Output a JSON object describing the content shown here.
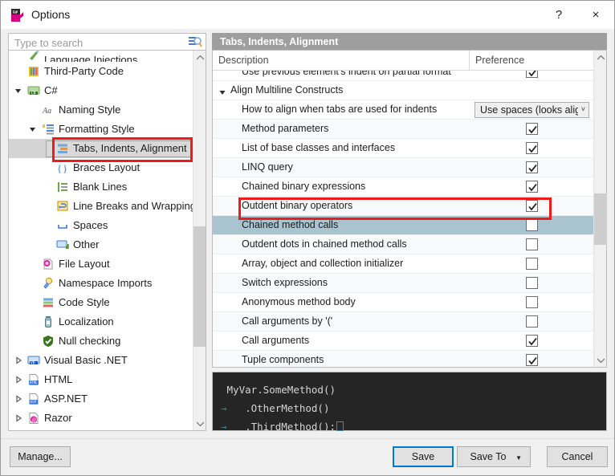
{
  "window": {
    "title": "Options",
    "icon": "resharper-icon",
    "help_label": "?",
    "close_label": "×"
  },
  "search": {
    "placeholder": "Type to search",
    "value": "",
    "icon": "search-icon"
  },
  "sidebar": {
    "items": [
      {
        "label": "Language Injections",
        "icon": "language-injections-icon",
        "indent": 1,
        "expander": "none",
        "clipped": true,
        "selected": false
      },
      {
        "label": "Third-Party Code",
        "icon": "third-party-code-icon",
        "indent": 1,
        "expander": "none",
        "selected": false
      },
      {
        "label": "C#",
        "icon": "csharp-icon",
        "indent": 1,
        "expander": "expanded",
        "selected": false
      },
      {
        "label": "Naming Style",
        "icon": "naming-style-icon",
        "indent": 2,
        "expander": "none",
        "selected": false
      },
      {
        "label": "Formatting Style",
        "icon": "formatting-style-icon",
        "indent": 2,
        "expander": "expanded",
        "selected": false
      },
      {
        "label": "Tabs, Indents, Alignment",
        "icon": "tabs-indents-alignment-icon",
        "indent": 3,
        "expander": "none",
        "selected": true
      },
      {
        "label": "Braces Layout",
        "icon": "braces-layout-icon",
        "indent": 3,
        "expander": "none",
        "selected": false
      },
      {
        "label": "Blank Lines",
        "icon": "blank-lines-icon",
        "indent": 3,
        "expander": "none",
        "selected": false
      },
      {
        "label": "Line Breaks and Wrapping",
        "icon": "line-breaks-wrapping-icon",
        "indent": 3,
        "expander": "none",
        "selected": false
      },
      {
        "label": "Spaces",
        "icon": "spaces-icon",
        "indent": 3,
        "expander": "none",
        "selected": false
      },
      {
        "label": "Other",
        "icon": "other-icon",
        "indent": 3,
        "expander": "none",
        "selected": false
      },
      {
        "label": "File Layout",
        "icon": "file-layout-icon",
        "indent": 2,
        "expander": "none",
        "selected": false
      },
      {
        "label": "Namespace Imports",
        "icon": "namespace-imports-icon",
        "indent": 2,
        "expander": "none",
        "selected": false
      },
      {
        "label": "Code Style",
        "icon": "code-style-icon",
        "indent": 2,
        "expander": "none",
        "selected": false
      },
      {
        "label": "Localization",
        "icon": "localization-icon",
        "indent": 2,
        "expander": "none",
        "selected": false
      },
      {
        "label": "Null checking",
        "icon": "null-checking-icon",
        "indent": 2,
        "expander": "none",
        "selected": false
      },
      {
        "label": "Visual Basic .NET",
        "icon": "visual-basic-net-icon",
        "indent": 1,
        "expander": "collapsed",
        "selected": false
      },
      {
        "label": "HTML",
        "icon": "html-icon",
        "indent": 1,
        "expander": "collapsed",
        "selected": false
      },
      {
        "label": "ASP.NET",
        "icon": "aspnet-icon",
        "indent": 1,
        "expander": "collapsed",
        "selected": false
      },
      {
        "label": "Razor",
        "icon": "razor-icon",
        "indent": 1,
        "expander": "collapsed",
        "selected": false
      }
    ]
  },
  "panel": {
    "header": "Tabs, Indents, Alignment",
    "columns": {
      "description": "Description",
      "preference": "Preference"
    },
    "rows": [
      {
        "label": "Use previous element's indent on partial format",
        "type": "checkbox",
        "checked": true,
        "clipped": true,
        "group": false,
        "selected": false
      },
      {
        "label": "Align Multiline Constructs",
        "type": "group",
        "group": true,
        "selected": false
      },
      {
        "label": "How to align when tabs are used for indents",
        "type": "combo",
        "value": "Use spaces (looks aligne",
        "group": false,
        "selected": false
      },
      {
        "label": "Method parameters",
        "type": "checkbox",
        "checked": true,
        "group": false,
        "selected": false
      },
      {
        "label": "List of base classes and interfaces",
        "type": "checkbox",
        "checked": true,
        "group": false,
        "selected": false
      },
      {
        "label": "LINQ query",
        "type": "checkbox",
        "checked": true,
        "group": false,
        "selected": false
      },
      {
        "label": "Chained binary expressions",
        "type": "checkbox",
        "checked": true,
        "group": false,
        "selected": false
      },
      {
        "label": "Outdent binary operators",
        "type": "checkbox",
        "checked": true,
        "group": false,
        "selected": false
      },
      {
        "label": "Chained method calls",
        "type": "checkbox",
        "checked": false,
        "group": false,
        "selected": true
      },
      {
        "label": "Outdent dots in chained method calls",
        "type": "checkbox",
        "checked": false,
        "group": false,
        "selected": false
      },
      {
        "label": "Array, object and collection initializer",
        "type": "checkbox",
        "checked": false,
        "group": false,
        "selected": false
      },
      {
        "label": "Switch expressions",
        "type": "checkbox",
        "checked": false,
        "group": false,
        "selected": false
      },
      {
        "label": "Anonymous method body",
        "type": "checkbox",
        "checked": false,
        "group": false,
        "selected": false
      },
      {
        "label": "Call arguments by '('",
        "type": "checkbox",
        "checked": false,
        "group": false,
        "selected": false
      },
      {
        "label": "Call arguments",
        "type": "checkbox",
        "checked": true,
        "group": false,
        "selected": false
      },
      {
        "label": "Tuple components",
        "type": "checkbox",
        "checked": true,
        "group": false,
        "selected": false
      }
    ]
  },
  "preview": {
    "lines": [
      {
        "tab": false,
        "text": "MyVar.SomeMethod()",
        "eof": false
      },
      {
        "tab": true,
        "text": "   .OtherMethod()",
        "eof": false
      },
      {
        "tab": true,
        "text": "   .ThirdMethod();",
        "eof": true
      }
    ]
  },
  "footer": {
    "manage": "Manage...",
    "save": "Save",
    "save_to": "Save To",
    "save_to_arrow": "▼",
    "cancel": "Cancel"
  },
  "colors": {
    "accent": "#0078d7",
    "selection_row": "#a9c3cf",
    "annotation": "#ee1b1b",
    "header_bar": "#9e9e9e",
    "preview_bg": "#252526"
  }
}
